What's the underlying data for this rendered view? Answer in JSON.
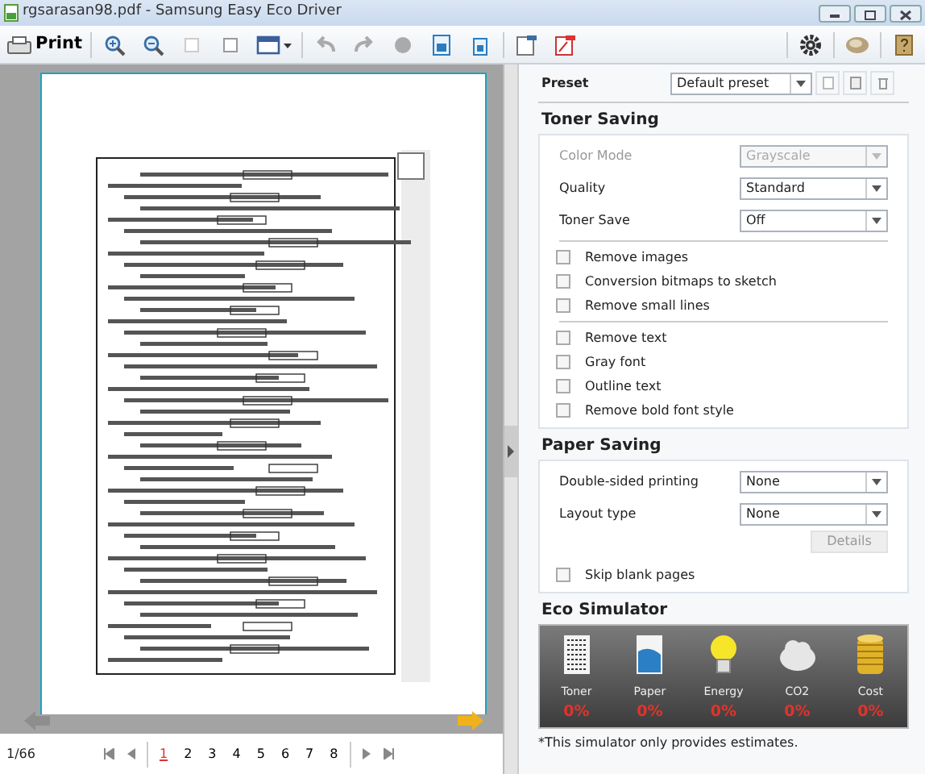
{
  "window": {
    "title": "rgsarasan98.pdf - Samsung Easy Eco Driver"
  },
  "toolbar": {
    "print_label": "Print"
  },
  "preset": {
    "label": "Preset",
    "value": "Default preset"
  },
  "toner_saving": {
    "title": "Toner Saving",
    "fields": [
      {
        "label": "Color Mode",
        "value": "Grayscale",
        "disabled": true
      },
      {
        "label": "Quality",
        "value": "Standard",
        "disabled": false
      },
      {
        "label": "Toner Save",
        "value": "Off",
        "disabled": false
      }
    ],
    "checkbox_groups": [
      [
        {
          "label": "Remove images",
          "checked": false
        },
        {
          "label": "Conversion bitmaps to sketch",
          "checked": false
        },
        {
          "label": "Remove small lines",
          "checked": false
        }
      ],
      [
        {
          "label": "Remove text",
          "checked": false
        },
        {
          "label": "Gray font",
          "checked": false
        },
        {
          "label": "Outline text",
          "checked": false
        },
        {
          "label": "Remove bold font style",
          "checked": false
        }
      ]
    ]
  },
  "paper_saving": {
    "title": "Paper Saving",
    "fields": [
      {
        "label": "Double-sided printing",
        "value": "None"
      },
      {
        "label": "Layout type",
        "value": "None"
      }
    ],
    "details_button": "Details",
    "checkboxes": [
      {
        "label": "Skip blank pages",
        "checked": false
      }
    ]
  },
  "eco_simulator": {
    "title": "Eco Simulator",
    "items": [
      {
        "kind": "toner",
        "label": "Toner",
        "value": "0%"
      },
      {
        "kind": "paper",
        "label": "Paper",
        "value": "0%"
      },
      {
        "kind": "energy",
        "label": "Energy",
        "value": "0%"
      },
      {
        "kind": "co2",
        "label": "CO2",
        "value": "0%"
      },
      {
        "kind": "cost",
        "label": "Cost",
        "value": "0%"
      }
    ],
    "note": "*This simulator only provides estimates."
  },
  "pagination": {
    "page_info": "1/66",
    "pages": [
      {
        "label": "1",
        "selected": true
      },
      {
        "label": "2",
        "selected": false
      },
      {
        "label": "3",
        "selected": false
      },
      {
        "label": "4",
        "selected": false
      },
      {
        "label": "5",
        "selected": false
      },
      {
        "label": "6",
        "selected": false
      },
      {
        "label": "7",
        "selected": false
      },
      {
        "label": "8",
        "selected": false
      }
    ]
  }
}
